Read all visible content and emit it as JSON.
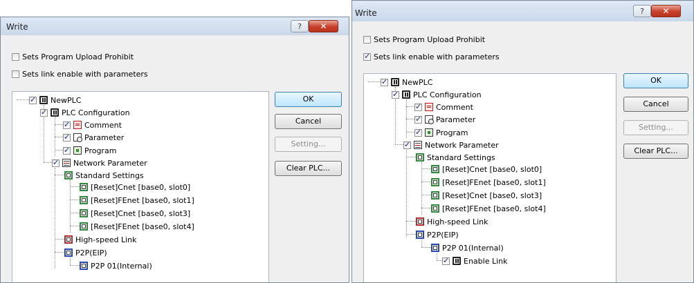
{
  "dialogs": [
    {
      "title": "Write",
      "help_glyph": "?",
      "close_glyph": "✕",
      "options": [
        {
          "label": "Sets Program Upload Prohibit",
          "checked": false
        },
        {
          "label": "Sets link enable with parameters",
          "checked": false
        }
      ],
      "tree": [
        {
          "label": "NewPLC",
          "icon": "plc",
          "checkbox": true
        },
        {
          "label": "PLC Configuration",
          "icon": "plc",
          "checkbox": true
        },
        {
          "label": "Comment",
          "icon": "comment",
          "checkbox": true
        },
        {
          "label": "Parameter",
          "icon": "parameter",
          "checkbox": true
        },
        {
          "label": "Program",
          "icon": "program",
          "checkbox": true
        },
        {
          "label": "Network Parameter",
          "icon": "network",
          "checkbox": true
        },
        {
          "label": "Standard Settings",
          "icon": "module-green",
          "checkbox": false
        },
        {
          "label": "[Reset]Cnet [base0, slot0]",
          "icon": "module",
          "checkbox": false
        },
        {
          "label": "[Reset]FEnet [base0, slot1]",
          "icon": "module",
          "checkbox": false
        },
        {
          "label": "[Reset]Cnet [base0, slot3]",
          "icon": "module",
          "checkbox": false
        },
        {
          "label": "[Reset]FEnet [base0, slot4]",
          "icon": "module",
          "checkbox": false
        },
        {
          "label": "High-speed Link",
          "icon": "module-red",
          "checkbox": false
        },
        {
          "label": "P2P(EIP)",
          "icon": "module-blue",
          "checkbox": false
        },
        {
          "label": "P2P 01(Internal)",
          "icon": "module-blue",
          "checkbox": false
        }
      ],
      "buttons": {
        "ok": "OK",
        "cancel": "Cancel",
        "setting": "Setting...",
        "clear": "Clear PLC..."
      }
    },
    {
      "title": "Write",
      "help_glyph": "?",
      "close_glyph": "✕",
      "options": [
        {
          "label": "Sets Program Upload Prohibit",
          "checked": false
        },
        {
          "label": "Sets link enable with parameters",
          "checked": true
        }
      ],
      "tree": [
        {
          "label": "NewPLC",
          "icon": "plc",
          "checkbox": true
        },
        {
          "label": "PLC Configuration",
          "icon": "plc",
          "checkbox": true
        },
        {
          "label": "Comment",
          "icon": "comment",
          "checkbox": true
        },
        {
          "label": "Parameter",
          "icon": "parameter",
          "checkbox": true
        },
        {
          "label": "Program",
          "icon": "program",
          "checkbox": true
        },
        {
          "label": "Network Parameter",
          "icon": "network",
          "checkbox": true
        },
        {
          "label": "Standard Settings",
          "icon": "module-green",
          "checkbox": false
        },
        {
          "label": "[Reset]Cnet [base0, slot0]",
          "icon": "module",
          "checkbox": false
        },
        {
          "label": "[Reset]FEnet [base0, slot1]",
          "icon": "module",
          "checkbox": false
        },
        {
          "label": "[Reset]Cnet [base0, slot3]",
          "icon": "module",
          "checkbox": false
        },
        {
          "label": "[Reset]FEnet [base0, slot4]",
          "icon": "module",
          "checkbox": false
        },
        {
          "label": "High-speed Link",
          "icon": "module-red",
          "checkbox": false
        },
        {
          "label": "P2P(EIP)",
          "icon": "module-blue",
          "checkbox": false
        },
        {
          "label": "P2P 01(Internal)",
          "icon": "module-blue",
          "checkbox": false
        },
        {
          "label": "Enable Link",
          "icon": "plc",
          "checkbox": true
        }
      ],
      "buttons": {
        "ok": "OK",
        "cancel": "Cancel",
        "setting": "Setting...",
        "clear": "Clear PLC..."
      }
    }
  ]
}
